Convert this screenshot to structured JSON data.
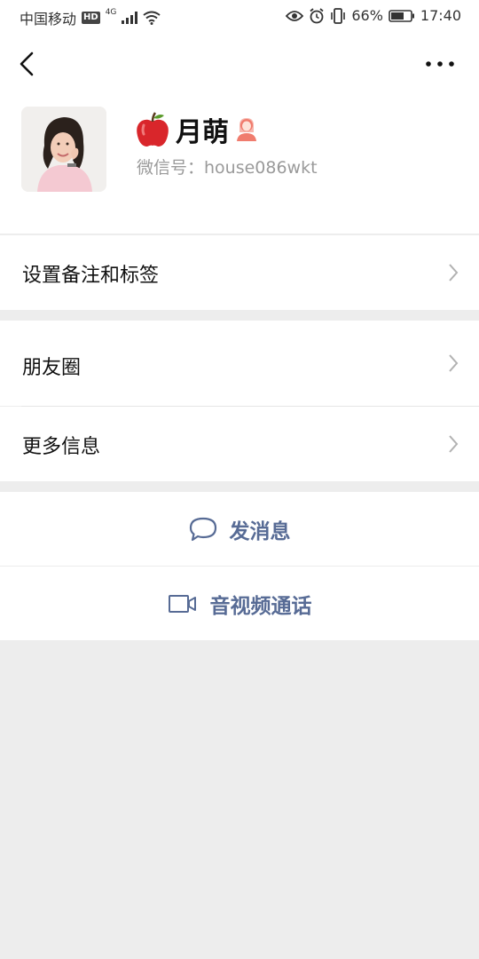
{
  "status_bar": {
    "carrier": "中国移动",
    "hd_badge": "HD",
    "network": "4G",
    "battery": "66%",
    "time": "17:40",
    "icons": [
      "signal-icon",
      "wifi-icon",
      "eye-icon",
      "alarm-icon",
      "vibrate-icon",
      "battery-icon"
    ]
  },
  "navbar": {
    "back_icon": "chevron-left-icon",
    "more_icon": "more-dots-icon"
  },
  "profile": {
    "name": "月萌",
    "name_prefix_icon": "apple-icon",
    "gender_icon": "female-icon",
    "wechat_id": "微信号：house086wkt"
  },
  "menu": {
    "remark_tags": "设置备注和标签",
    "moments": "朋友圈",
    "more_info": "更多信息"
  },
  "actions": {
    "send_message": "发消息",
    "av_call": "音视频通话"
  },
  "colors": {
    "link": "#576b95",
    "background": "#ededed",
    "female_icon": "#f07c6e"
  }
}
